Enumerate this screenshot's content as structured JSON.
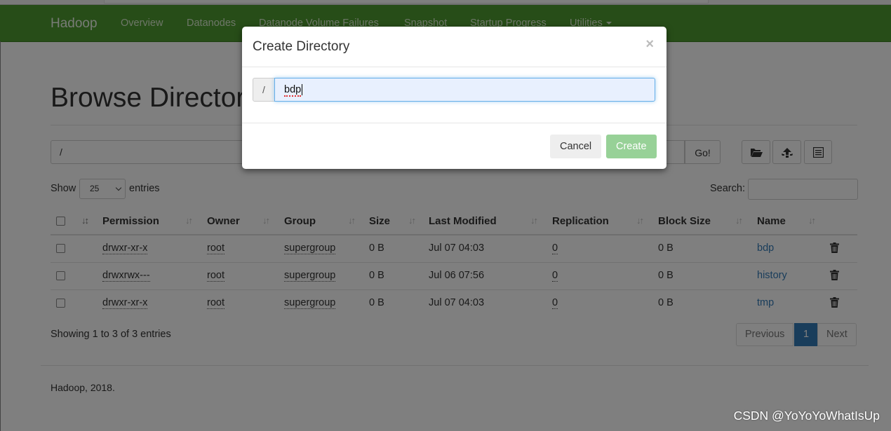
{
  "navbar": {
    "brand": "Hadoop",
    "links": [
      "Overview",
      "Datanodes",
      "Datanode Volume Failures",
      "Snapshot",
      "Startup Progress",
      "Utilities"
    ]
  },
  "page": {
    "title": "Browse Directory",
    "path_value": "/",
    "go_label": "Go!",
    "show_label": "Show",
    "entries_select": "25",
    "entries_label": "entries",
    "search_label": "Search:",
    "icons": [
      "folder-open-icon",
      "upload-icon",
      "list-icon"
    ]
  },
  "table": {
    "columns": [
      "Permission",
      "Owner",
      "Group",
      "Size",
      "Last Modified",
      "Replication",
      "Block Size",
      "Name"
    ],
    "rows": [
      {
        "permission": "drwxr-xr-x",
        "owner": "root",
        "group": "supergroup",
        "size": "0 B",
        "modified": "Jul 07 04:03",
        "replication": "0",
        "block_size": "0 B",
        "name": "bdp"
      },
      {
        "permission": "drwxrwx---",
        "owner": "root",
        "group": "supergroup",
        "size": "0 B",
        "modified": "Jul 06 07:56",
        "replication": "0",
        "block_size": "0 B",
        "name": "history"
      },
      {
        "permission": "drwxr-xr-x",
        "owner": "root",
        "group": "supergroup",
        "size": "0 B",
        "modified": "Jul 07 04:03",
        "replication": "0",
        "block_size": "0 B",
        "name": "tmp"
      }
    ],
    "summary": "Showing 1 to 3 of 3 entries"
  },
  "pagination": {
    "previous": "Previous",
    "current": "1",
    "next": "Next"
  },
  "footer": "Hadoop, 2018.",
  "modal": {
    "title": "Create Directory",
    "close": "×",
    "prefix": "/",
    "input_value": "bdp",
    "cancel": "Cancel",
    "create": "Create"
  },
  "watermark": "CSDN @YoYoYoWhatIsUp",
  "colors": {
    "navbar": "#4f9a31",
    "primary": "#337ab7",
    "create_button": "#97d197"
  }
}
